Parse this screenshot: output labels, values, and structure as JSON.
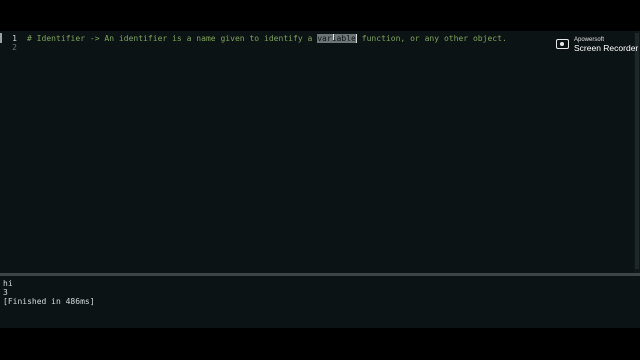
{
  "editor": {
    "line_numbers": [
      "1",
      "2"
    ],
    "line1": {
      "before_selection": "# Identifier -> An identifier is a name given to identify a ",
      "selection": "variable",
      "after_cursor": " function, or any other object."
    },
    "line2": ""
  },
  "watermark": {
    "brand": "Apowersoft",
    "product": "Screen Recorder"
  },
  "output": {
    "lines": [
      "hi",
      "3",
      "[Finished in 486ms]"
    ]
  },
  "colors": {
    "editor_background": "#0c1314",
    "comment": "#7fa35d",
    "selection": "#6d7577",
    "output_text": "#d8dcdc"
  },
  "icons": {
    "watermark": "camera-icon"
  }
}
